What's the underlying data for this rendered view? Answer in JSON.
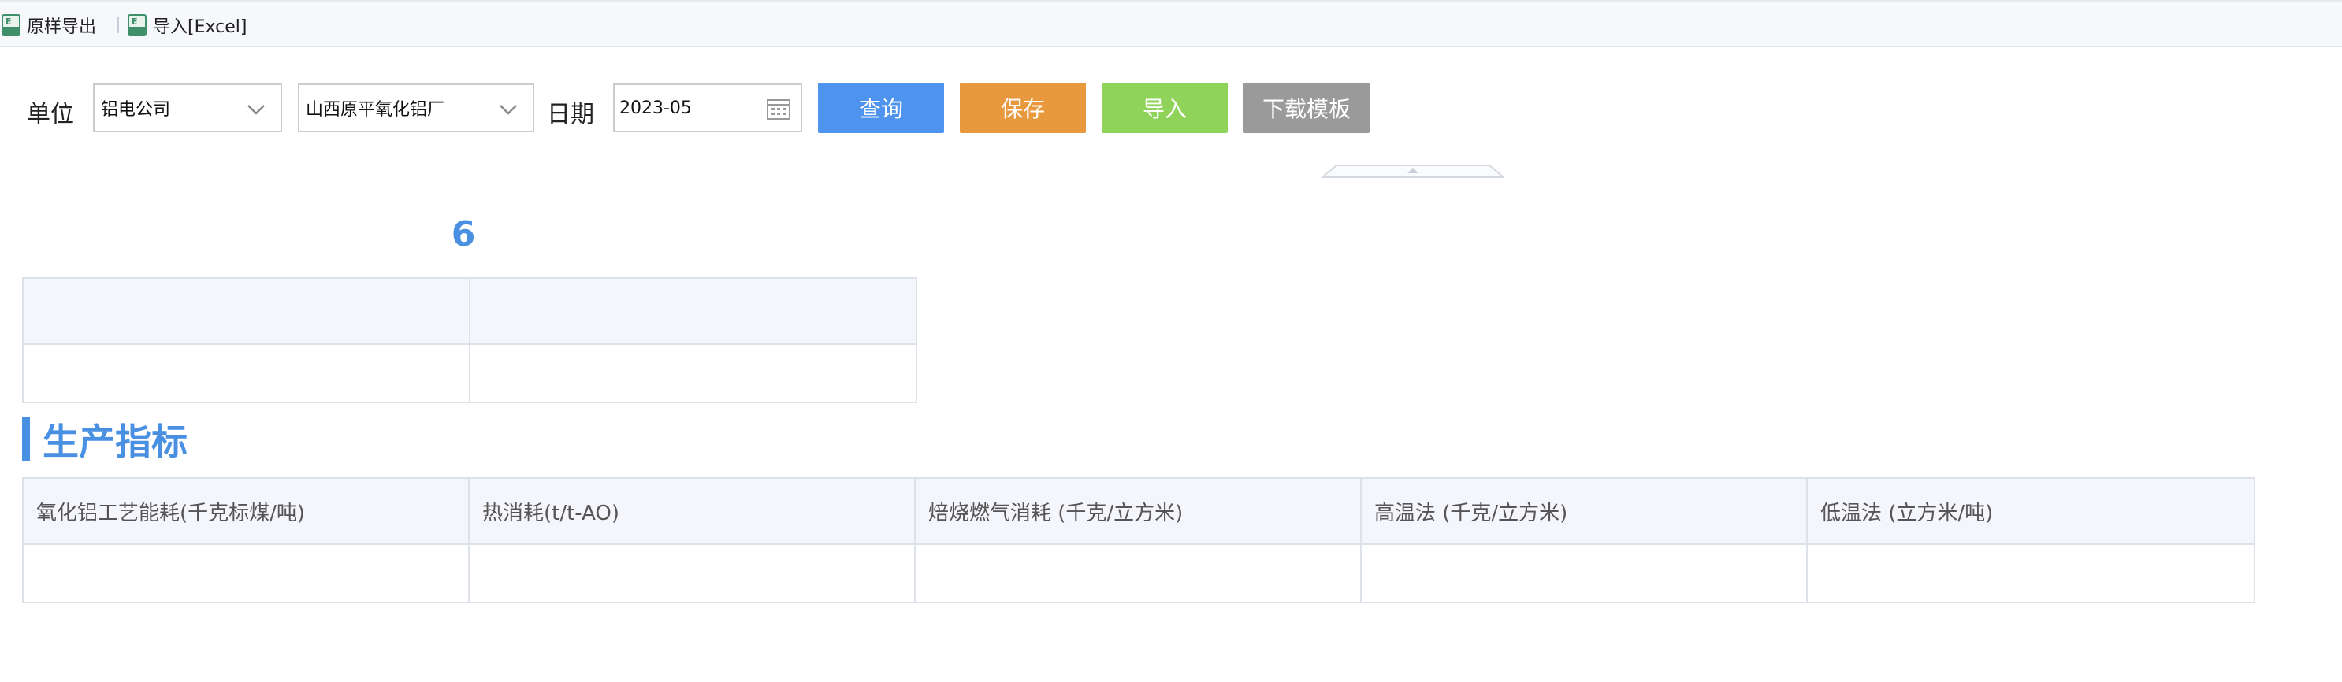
{
  "toolbar": {
    "export_label": "原样导出",
    "import_label": "导入[Excel]"
  },
  "filters": {
    "unit_label": "单位",
    "company_value": "铝电公司",
    "plant_value": "山西原平氧化铝厂",
    "date_label": "日期",
    "date_value": "2023-05"
  },
  "buttons": {
    "query": "查询",
    "save": "保存",
    "import": "导入",
    "download_template": "下载模板"
  },
  "colors": {
    "query": "#4e94ee",
    "save": "#e8993e",
    "import": "#8fd35a",
    "download_template": "#9a9a9a",
    "accent": "#4a90e2"
  },
  "summary": {
    "number": "6"
  },
  "section": {
    "title": "生产指标"
  },
  "production_table": {
    "headers": [
      "氧化铝工艺能耗(千克标煤/吨)",
      "热消耗(t/t-AO)",
      "焙烧燃气消耗 (千克/立方米)",
      "高温法 (千克/立方米)",
      "低温法 (立方米/吨)"
    ]
  }
}
